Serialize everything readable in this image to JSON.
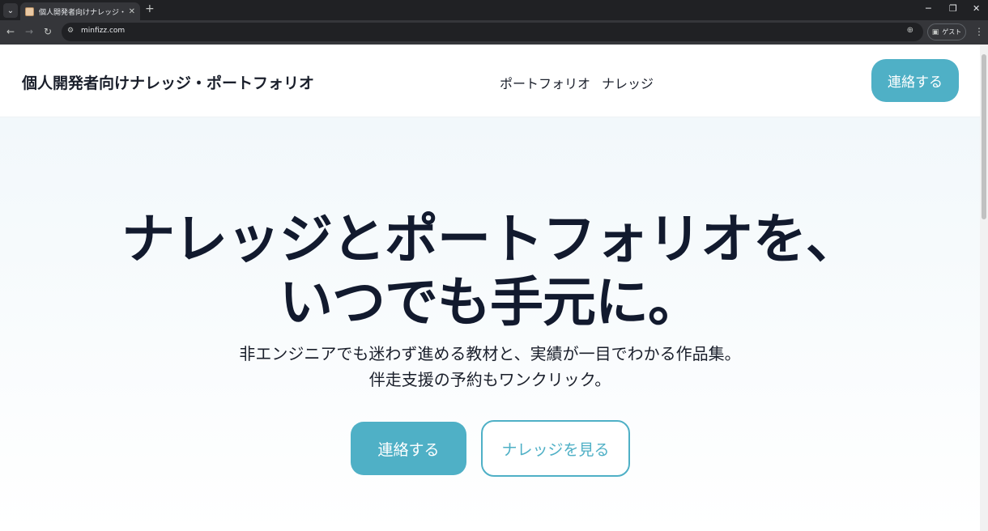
{
  "browser": {
    "tab_title": "個人開発者向けナレッジ・ポートフォ",
    "url": "minfizz.com",
    "profile_label": "ゲスト"
  },
  "site": {
    "brand": "個人開発者向けナレッジ・ポートフォリオ",
    "nav": [
      "ポートフォリオ",
      "ナレッジ"
    ],
    "header_cta": "連絡する"
  },
  "hero": {
    "headline_line1": "ナレッジとポートフォリオを、",
    "headline_line2": "いつでも手元に。",
    "sub_line1": "非エンジニアでも迷わず進める教材と、実績が一目でわかる作品集。",
    "sub_line2": "伴走支援の予約もワンクリック。",
    "primary_button": "連絡する",
    "secondary_button": "ナレッジを見る"
  },
  "colors": {
    "accent": "#4fb0c6",
    "text_dark": "#121a2e"
  }
}
